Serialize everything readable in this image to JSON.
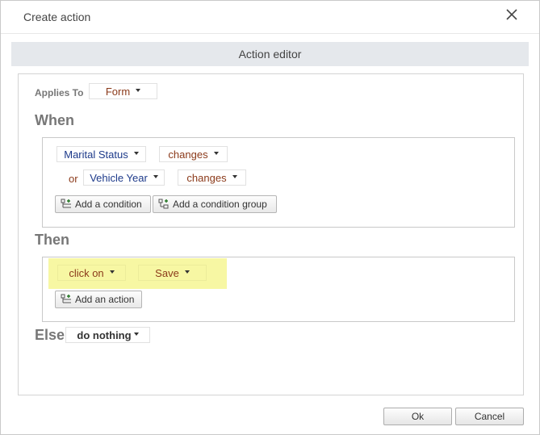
{
  "dialog": {
    "title": "Create action"
  },
  "editor": {
    "header": "Action editor"
  },
  "applies_to": {
    "label": "Applies To",
    "value": "Form"
  },
  "when": {
    "label": "When",
    "conditions": [
      {
        "connector": "",
        "field": "Marital Status",
        "operator": "changes"
      },
      {
        "connector": "or",
        "field": "Vehicle Year",
        "operator": "changes"
      }
    ],
    "add_condition": "Add a condition",
    "add_condition_group": "Add a condition group"
  },
  "then": {
    "label": "Then",
    "actions": [
      {
        "action": "click on",
        "target": "Save"
      }
    ],
    "add_action": "Add an action"
  },
  "else": {
    "label": "Else",
    "value": "do nothing"
  },
  "footer": {
    "ok": "Ok",
    "cancel": "Cancel"
  },
  "colors": {
    "highlight": "#f7f7a3",
    "field_text": "#1d3a8a",
    "operator_text": "#8b3a1a",
    "header_bg": "#e5e8ec"
  }
}
